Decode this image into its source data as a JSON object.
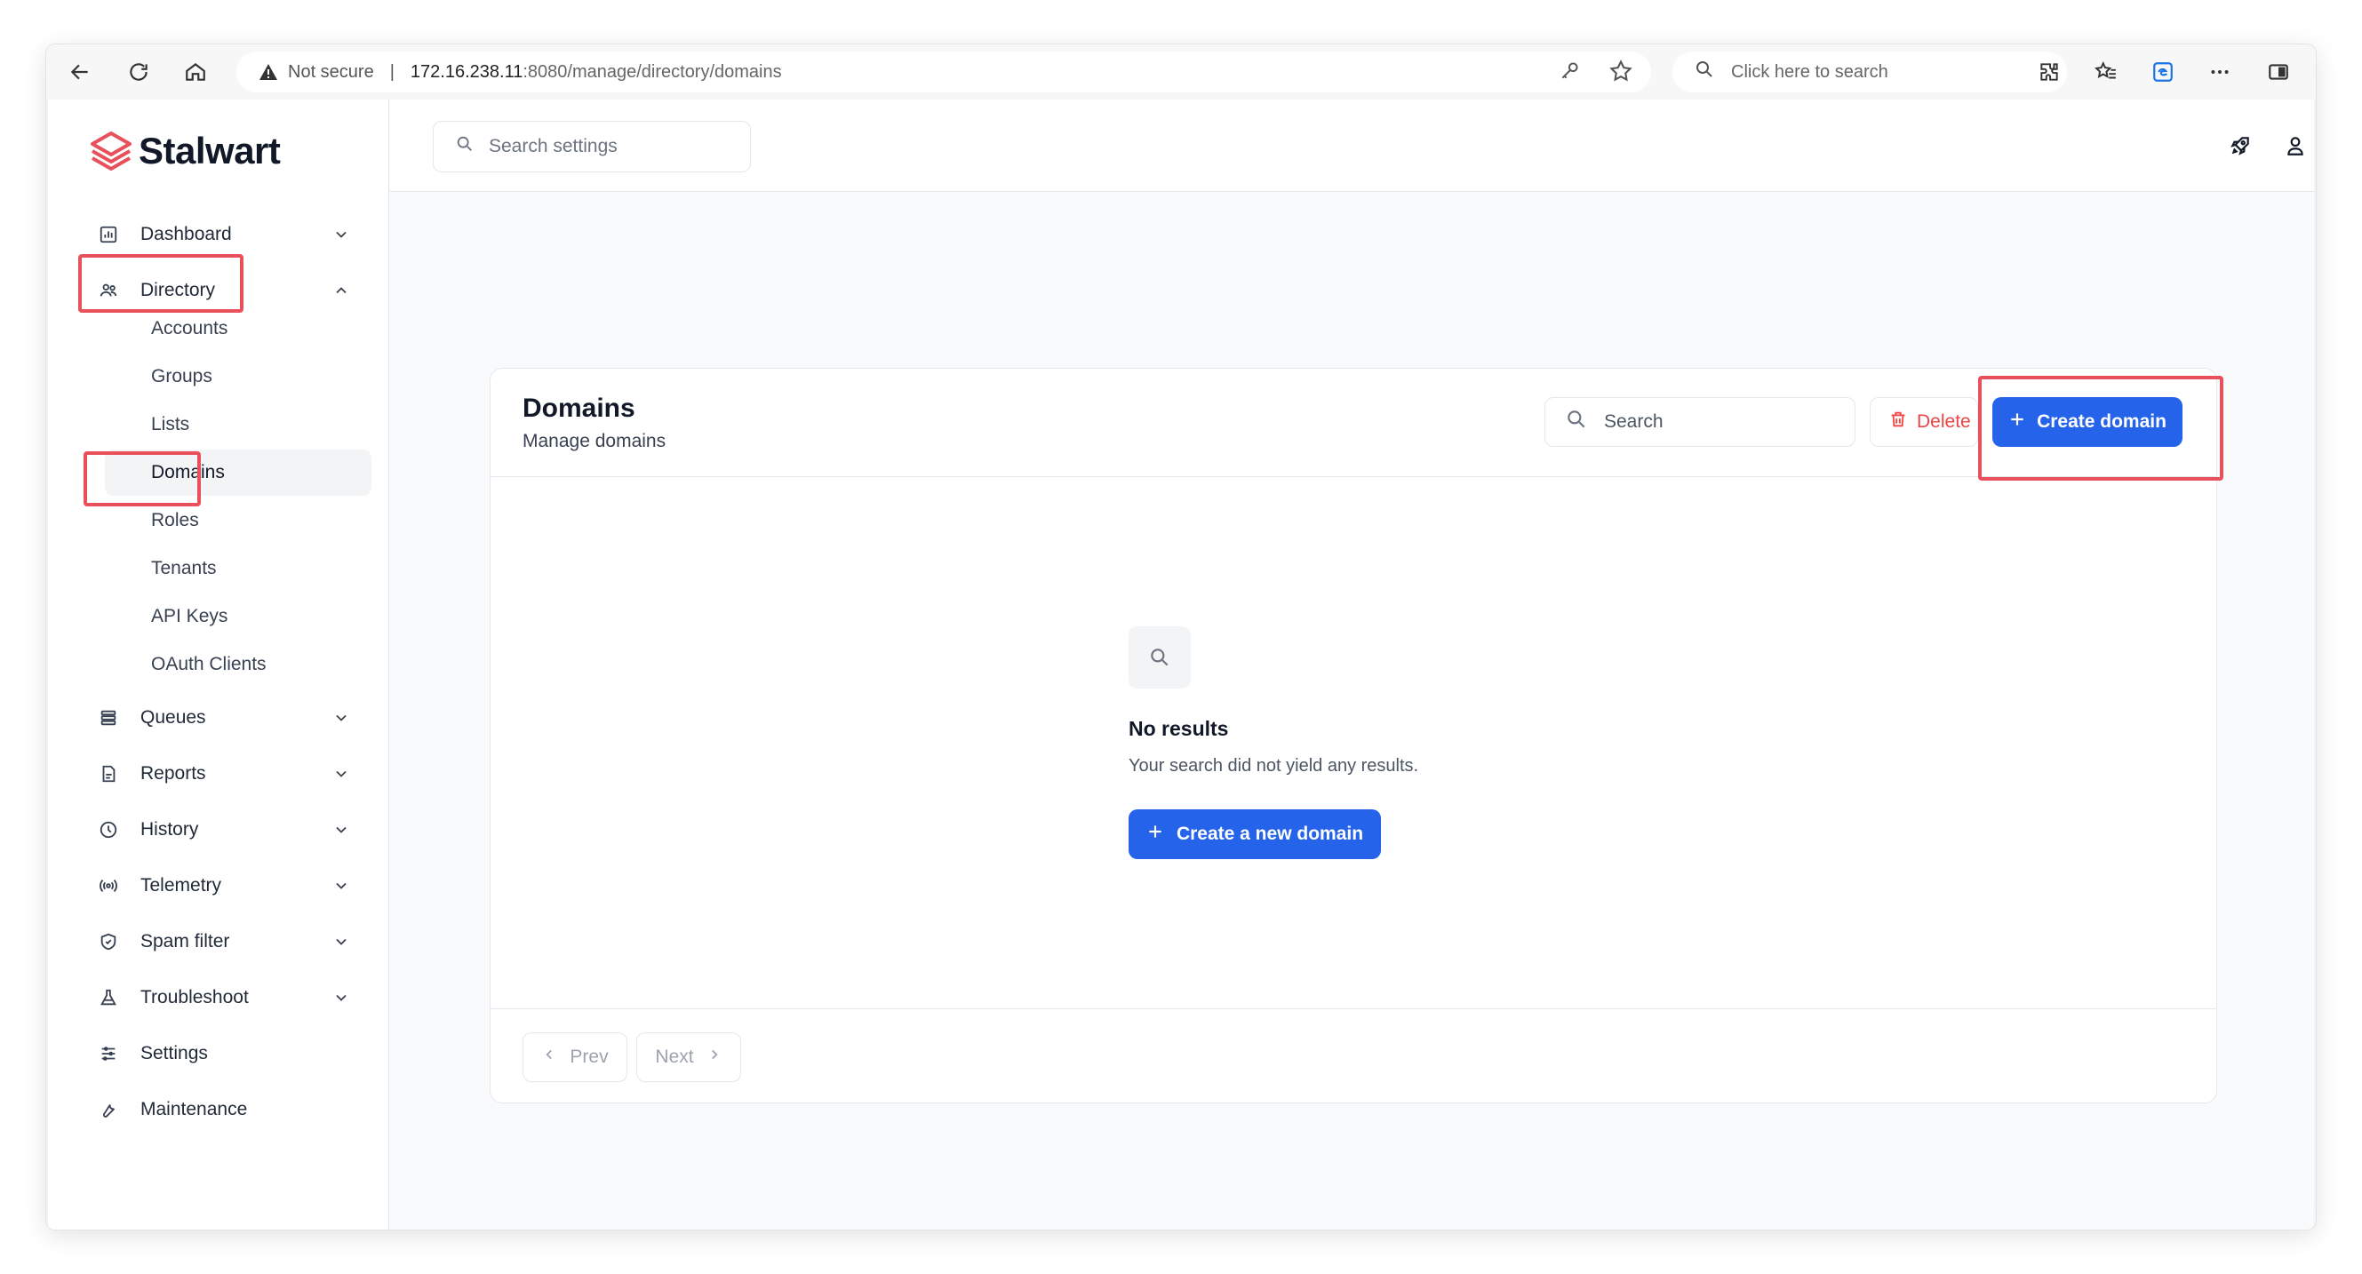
{
  "browser": {
    "security_label": "Not secure",
    "url_host": "172.16.238.11",
    "url_path": ":8080/manage/directory/domains",
    "search_placeholder": "Click here to search"
  },
  "app": {
    "brand": "Stalwart",
    "settings_search_placeholder": "Search settings"
  },
  "sidebar": {
    "items": [
      {
        "label": "Dashboard",
        "icon": "dashboard-icon",
        "expandable": true
      },
      {
        "label": "Directory",
        "icon": "directory-icon",
        "expandable": true,
        "expanded": true
      },
      {
        "label": "Queues",
        "icon": "queues-icon",
        "expandable": true
      },
      {
        "label": "Reports",
        "icon": "reports-icon",
        "expandable": true
      },
      {
        "label": "History",
        "icon": "history-icon",
        "expandable": true
      },
      {
        "label": "Telemetry",
        "icon": "telemetry-icon",
        "expandable": true
      },
      {
        "label": "Spam filter",
        "icon": "shield-icon",
        "expandable": true
      },
      {
        "label": "Troubleshoot",
        "icon": "flask-icon",
        "expandable": true
      },
      {
        "label": "Settings",
        "icon": "sliders-icon",
        "expandable": false
      },
      {
        "label": "Maintenance",
        "icon": "wrench-icon",
        "expandable": false
      }
    ],
    "directory_sub": [
      {
        "label": "Accounts"
      },
      {
        "label": "Groups"
      },
      {
        "label": "Lists"
      },
      {
        "label": "Domains",
        "active": true
      },
      {
        "label": "Roles"
      },
      {
        "label": "Tenants"
      },
      {
        "label": "API Keys"
      },
      {
        "label": "OAuth Clients"
      }
    ]
  },
  "card": {
    "title": "Domains",
    "subtitle": "Manage domains",
    "search_placeholder": "Search",
    "delete_label": "Delete",
    "create_label": "Create domain",
    "empty_title": "No results",
    "empty_desc": "Your search did not yield any results.",
    "new_domain_label": "Create a new domain",
    "prev_label": "Prev",
    "next_label": "Next"
  },
  "colors": {
    "primary": "#2563eb",
    "danger": "#ef4444",
    "highlight": "#e8505b",
    "brand": "#e8505b"
  }
}
